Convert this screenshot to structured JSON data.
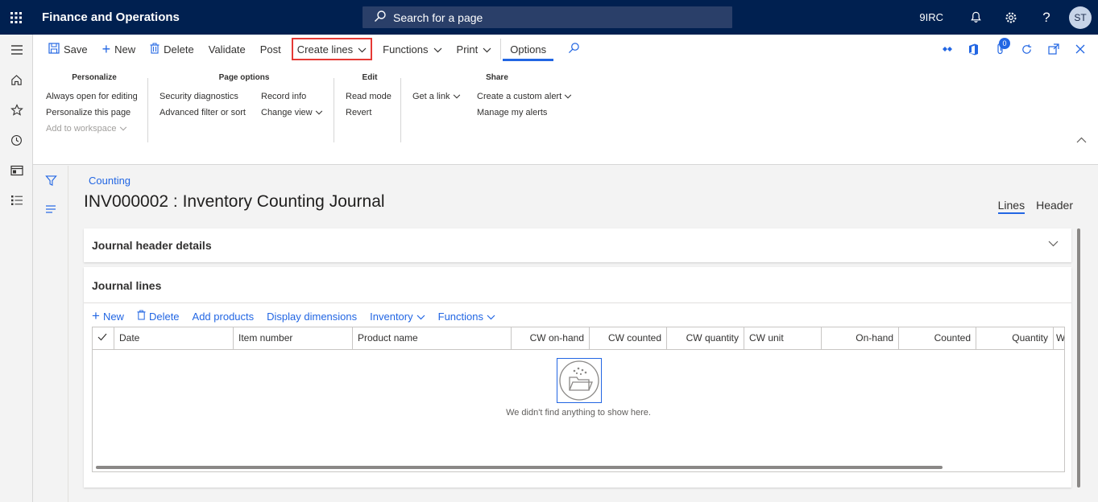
{
  "topbar": {
    "app_title": "Finance and Operations",
    "search_placeholder": "Search for a page",
    "company": "9IRC",
    "avatar_initials": "ST"
  },
  "actionpane": {
    "save": "Save",
    "new": "New",
    "delete": "Delete",
    "validate": "Validate",
    "post": "Post",
    "create_lines": "Create lines",
    "functions": "Functions",
    "print": "Print",
    "options": "Options",
    "notification_count": "0"
  },
  "ribbon": {
    "personalize": {
      "title": "Personalize",
      "items": [
        "Always open for editing",
        "Personalize this page",
        "Add to workspace"
      ]
    },
    "page_options": {
      "title": "Page options",
      "col1": [
        "Security diagnostics",
        "Advanced filter or sort"
      ],
      "col2": [
        "Record info",
        "Change view"
      ]
    },
    "edit": {
      "title": "Edit",
      "items": [
        "Read mode",
        "Revert"
      ]
    },
    "share": {
      "title": "Share",
      "get_link": "Get a link",
      "items": [
        "Create a custom alert",
        "Manage my alerts"
      ]
    }
  },
  "page": {
    "breadcrumb": "Counting",
    "title": "INV000002 : Inventory Counting Journal",
    "view_tabs": [
      "Lines",
      "Header"
    ],
    "header_fasttab": "Journal header details",
    "lines_title": "Journal lines"
  },
  "grid_toolbar": {
    "new": "New",
    "delete": "Delete",
    "add_products": "Add products",
    "display_dimensions": "Display dimensions",
    "inventory": "Inventory",
    "functions": "Functions"
  },
  "grid": {
    "columns": [
      "Date",
      "Item number",
      "Product name",
      "CW on-hand",
      "CW counted",
      "CW quantity",
      "CW unit",
      "On-hand",
      "Counted",
      "Quantity",
      "W"
    ],
    "empty_message": "We didn't find anything to show here."
  },
  "colors": {
    "nav_bg": "#002050",
    "accent": "#2266e3",
    "highlight": "#e53935"
  }
}
